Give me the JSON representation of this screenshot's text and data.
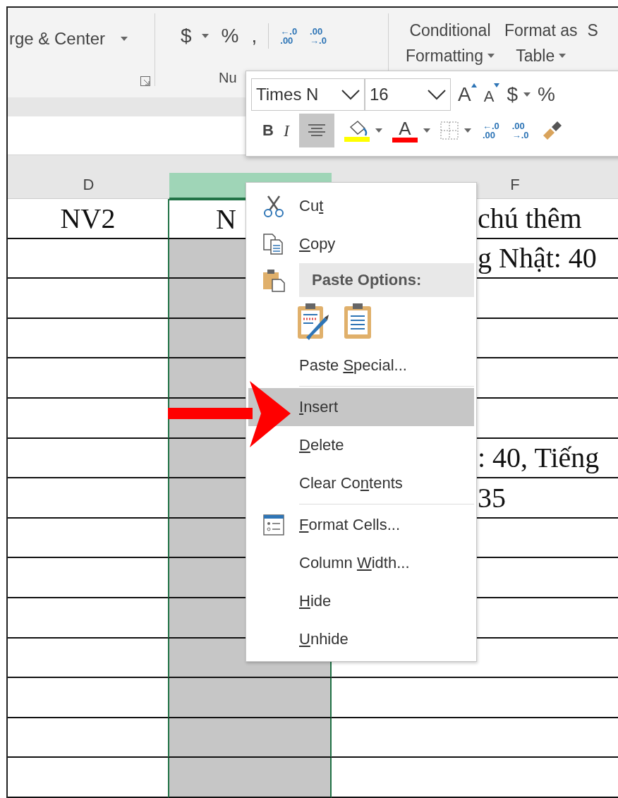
{
  "ribbon": {
    "alignment_group": {
      "merge_label": "rge & Center",
      "dropdown": true
    },
    "number_group": {
      "label": "Nu",
      "buttons": [
        {
          "kind": "text",
          "label": "$",
          "dropdown": true
        },
        {
          "kind": "text",
          "label": "%"
        },
        {
          "kind": "text",
          "label": ","
        },
        {
          "kind": "divider"
        },
        {
          "kind": "decimal",
          "lines": [
            "←.0",
            ".00"
          ]
        },
        {
          "kind": "decimal",
          "lines": [
            ".00",
            "→.0"
          ]
        }
      ]
    },
    "styles_group": {
      "buttons": [
        {
          "lines": [
            "Conditional",
            "Formatting"
          ],
          "dropdown": true
        },
        {
          "lines": [
            "Format as",
            "Table"
          ],
          "dropdown": true
        },
        {
          "lines": [
            "S"
          ]
        }
      ]
    }
  },
  "columns": [
    {
      "header": "D",
      "selected": false
    },
    {
      "selected": true
    },
    {
      "header": "F",
      "selected": false
    }
  ],
  "rows": [
    [
      "NV2",
      "N",
      "chú thêm"
    ],
    [
      null,
      null,
      "g Nhật: 40"
    ],
    [
      null,
      null,
      null
    ],
    [
      null,
      null,
      null
    ],
    [
      null,
      null,
      null
    ],
    [
      null,
      null,
      null
    ],
    [
      null,
      null,
      ": 40, Tiếng"
    ],
    [
      null,
      null,
      "35"
    ],
    [
      null,
      null,
      null
    ],
    [
      null,
      null,
      null
    ],
    [
      null,
      null,
      null
    ],
    [
      null,
      null,
      null
    ],
    [
      null,
      null,
      null
    ],
    [
      null,
      null,
      null
    ],
    [
      null,
      null,
      null
    ]
  ],
  "mini_toolbar": {
    "font_name": "Times N",
    "font_size": "16",
    "row1": [
      {
        "kind": "grow",
        "label": "A"
      },
      {
        "kind": "shrink",
        "label": "A"
      },
      {
        "kind": "text",
        "label": "$",
        "dropdown": true
      },
      {
        "kind": "text",
        "label": "%"
      }
    ],
    "row2": [
      {
        "kind": "bold",
        "label": "B"
      },
      {
        "kind": "italic",
        "label": "I"
      },
      {
        "kind": "align",
        "selected": true
      },
      {
        "kind": "fill",
        "color": "#ffff00",
        "dropdown": true
      },
      {
        "kind": "font_color",
        "label": "A",
        "color": "#ff0000",
        "dropdown": true
      },
      {
        "kind": "borders",
        "dropdown": true
      },
      {
        "kind": "decimal",
        "lines": [
          "←.0",
          ".00"
        ]
      },
      {
        "kind": "decimal",
        "lines": [
          ".00",
          "→.0"
        ]
      },
      {
        "kind": "painter"
      }
    ]
  },
  "context_menu": {
    "items": [
      {
        "kind": "cut",
        "label": {
          "before": "Cu",
          "key": "t"
        },
        "selected": false
      },
      {
        "kind": "copy",
        "label": {
          "key": "C",
          "after": "opy"
        },
        "selected": false
      },
      {
        "kind": "header",
        "label": "Paste Options:"
      },
      {
        "kind": "paste_icons"
      },
      {
        "kind": "command",
        "label": {
          "before": "Paste ",
          "key": "S",
          "after": "pecial..."
        },
        "selected": false
      },
      {
        "kind": "command",
        "label": {
          "key": "I",
          "after": "nsert"
        },
        "selected": true,
        "separator_before": true
      },
      {
        "kind": "command",
        "label": {
          "key": "D",
          "after": "elete"
        },
        "selected": false
      },
      {
        "kind": "command",
        "label": {
          "before": "Clear Co",
          "key": "n",
          "after": "tents"
        },
        "selected": false
      },
      {
        "kind": "format_cells",
        "label": {
          "key": "F",
          "after": "ormat Cells..."
        },
        "selected": false,
        "separator_before": true
      },
      {
        "kind": "command",
        "label": {
          "before": "Column ",
          "key": "W",
          "after": "idth..."
        },
        "selected": false
      },
      {
        "kind": "command",
        "label": {
          "key": "H",
          "after": "ide"
        },
        "selected": false
      },
      {
        "kind": "command",
        "label": {
          "key": "U",
          "after": "nhide"
        },
        "selected": false
      }
    ]
  }
}
